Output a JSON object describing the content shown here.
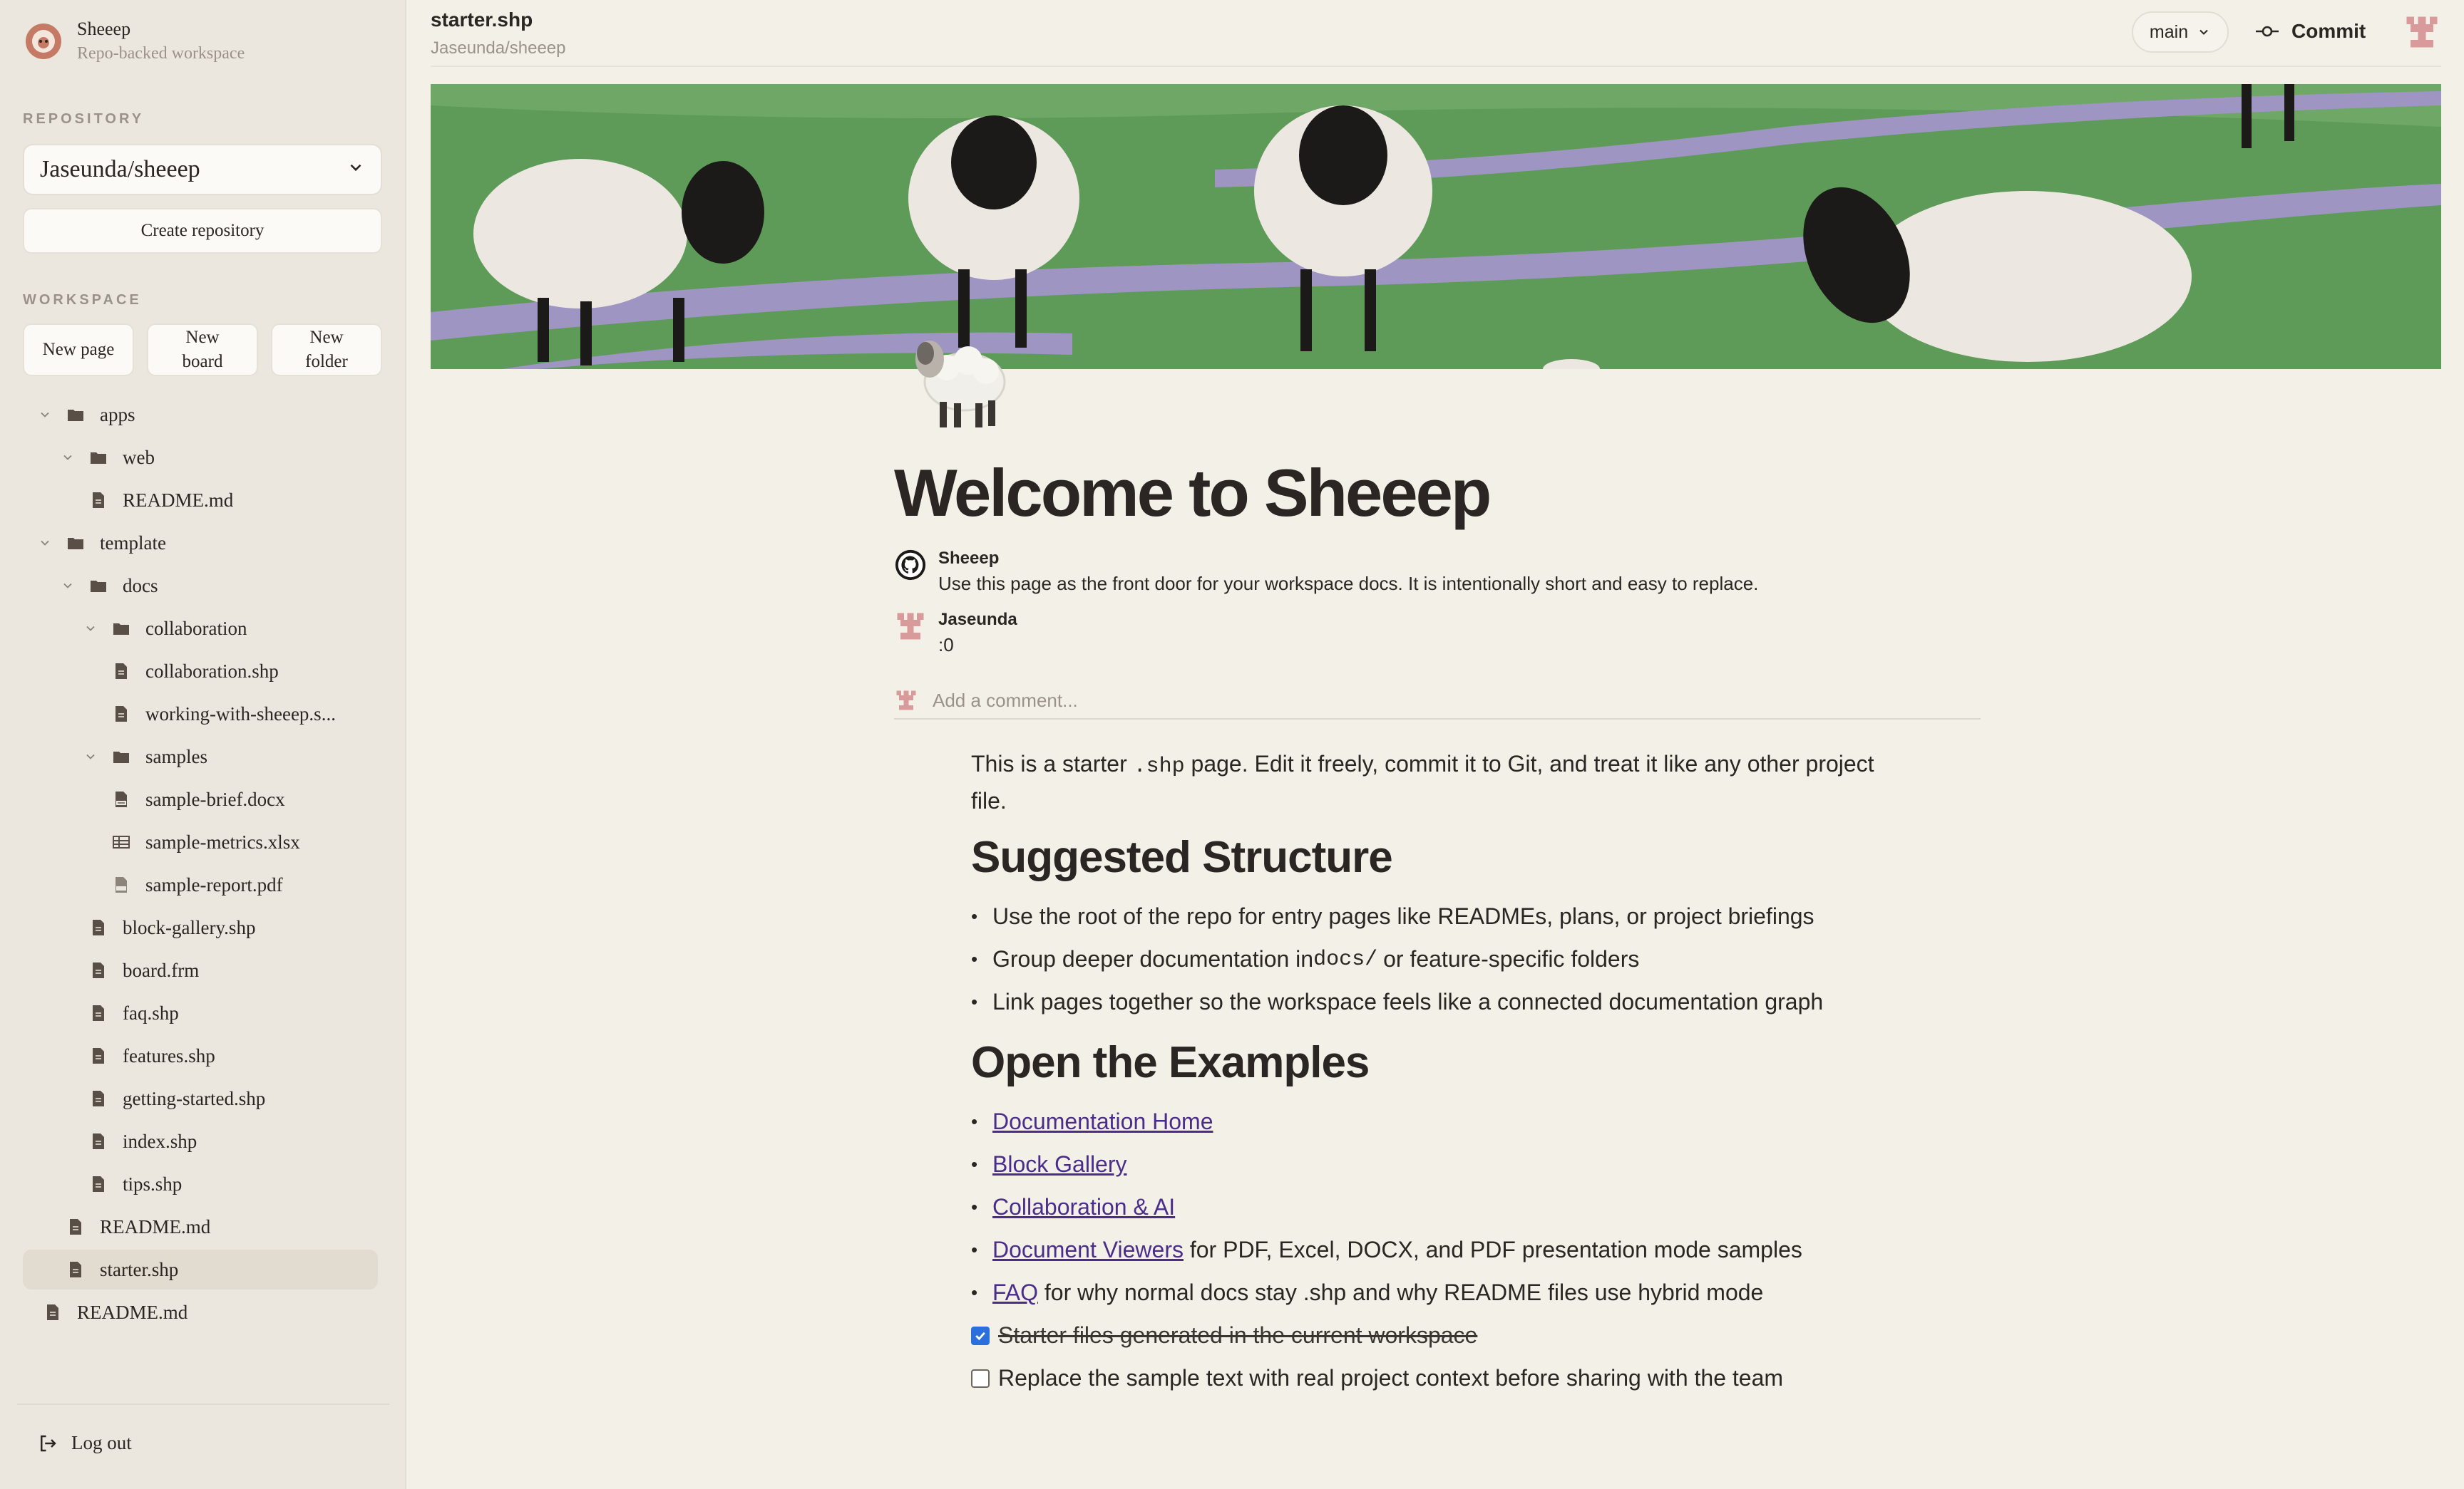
{
  "sidebar": {
    "brand_name": "Sheeep",
    "brand_sub": "Repo-backed workspace",
    "repository_label": "REPOSITORY",
    "repo_selected": "Jaseunda/sheeep",
    "create_repo": "Create repository",
    "workspace_label": "WORKSPACE",
    "new_page": "New page",
    "new_board": "New board",
    "new_folder": "New folder",
    "tree": [
      {
        "label": "apps",
        "type": "folder",
        "depth": 0
      },
      {
        "label": "web",
        "type": "folder",
        "depth": 1
      },
      {
        "label": "README.md",
        "type": "file",
        "depth": 2
      },
      {
        "label": "template",
        "type": "folder",
        "depth": 0
      },
      {
        "label": "docs",
        "type": "folder",
        "depth": 1
      },
      {
        "label": "collaboration",
        "type": "folder",
        "depth": 2
      },
      {
        "label": "collaboration.shp",
        "type": "file",
        "depth": 3
      },
      {
        "label": "working-with-sheeep.s...",
        "type": "file",
        "depth": 3
      },
      {
        "label": "samples",
        "type": "folder",
        "depth": 2
      },
      {
        "label": "sample-brief.docx",
        "type": "docx",
        "depth": 3
      },
      {
        "label": "sample-metrics.xlsx",
        "type": "xlsx",
        "depth": 3
      },
      {
        "label": "sample-report.pdf",
        "type": "pdf",
        "depth": 3
      },
      {
        "label": "block-gallery.shp",
        "type": "file",
        "depth": 2
      },
      {
        "label": "board.frm",
        "type": "file",
        "depth": 2
      },
      {
        "label": "faq.shp",
        "type": "file",
        "depth": 2
      },
      {
        "label": "features.shp",
        "type": "file",
        "depth": 2
      },
      {
        "label": "getting-started.shp",
        "type": "file",
        "depth": 2
      },
      {
        "label": "index.shp",
        "type": "file",
        "depth": 2
      },
      {
        "label": "tips.shp",
        "type": "file",
        "depth": 2
      },
      {
        "label": "README.md",
        "type": "file",
        "depth": 1
      },
      {
        "label": "starter.shp",
        "type": "file",
        "depth": 1,
        "active": true
      },
      {
        "label": "README.md",
        "type": "file",
        "depth": 0
      }
    ],
    "logout": "Log out"
  },
  "topbar": {
    "title": "starter.shp",
    "subtitle": "Jaseunda/sheeep",
    "branch": "main",
    "commit": "Commit"
  },
  "page": {
    "title": "Welcome to Sheeep",
    "comments": [
      {
        "author": "Sheeep",
        "text": "Use this page as the front door for your workspace docs. It is intentionally short and easy to replace."
      },
      {
        "author": "Jaseunda",
        "text": ":0"
      }
    ],
    "add_comment_placeholder": "Add a comment...",
    "intro_a": "This is a starter ",
    "intro_code": ".shp",
    "intro_b": " page. Edit it freely, commit it to Git, and treat it like any other project file.",
    "h_structure": "Suggested Structure",
    "structure_1": "Use the root of the repo for entry pages like READMEs, plans, or project briefings",
    "structure_2a": "Group deeper documentation in ",
    "structure_2code": "docs/",
    "structure_2b": " or feature-specific folders",
    "structure_3": "Link pages together so the workspace feels like a connected documentation graph",
    "h_examples": "Open the Examples",
    "link_docs_home": "Documentation Home",
    "link_block_gallery": "Block Gallery",
    "link_collab": "Collaboration & AI",
    "link_viewers": "Document Viewers",
    "viewers_rest": " for PDF, Excel, DOCX, and PDF presentation mode samples",
    "link_faq": "FAQ",
    "faq_rest": " for why normal docs stay .shp and why README files use hybrid mode",
    "todo_1": "Starter files generated in the current workspace",
    "todo_1_checked": true,
    "todo_2": "Replace the sample text with real project context before sharing with the team",
    "todo_2_checked": false
  },
  "colors": {
    "background": "#f3f0e8",
    "sidebar": "#ece7de",
    "link": "#4a2c8a",
    "checkbox": "#2a6fdb"
  }
}
